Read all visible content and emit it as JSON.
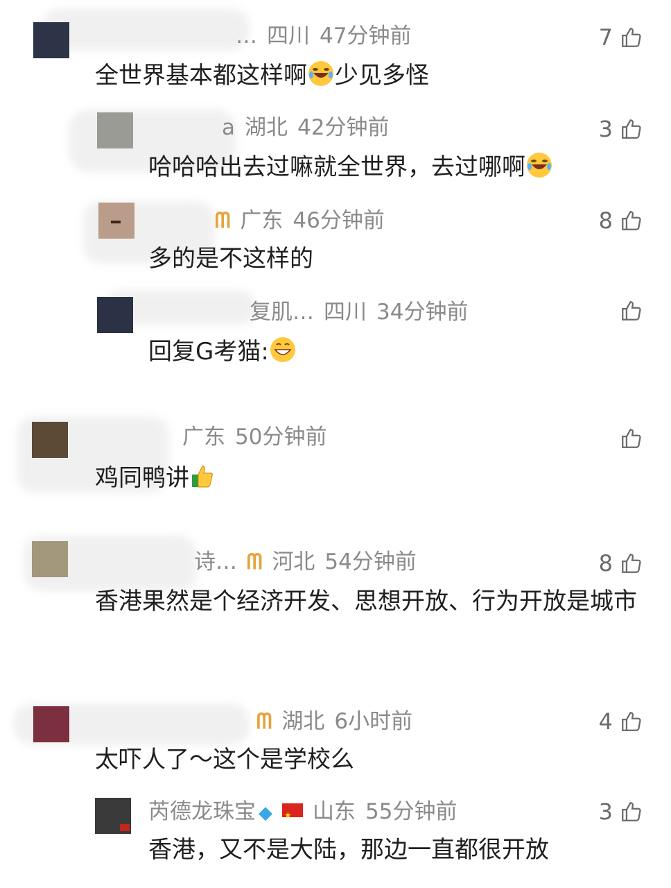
{
  "comments": [
    {
      "name_visible": "…",
      "location": "四川",
      "time": "47分钟前",
      "likes": "7",
      "text": "全世界基本都这样啊",
      "text_tail": "少见多怪",
      "emoji": "rofl"
    },
    {
      "name_visible": "a",
      "location": "湖北",
      "time": "42分钟前",
      "likes": "3",
      "text": "哈哈哈出去过嘛就全世界，去过哪啊",
      "emoji": "rofl"
    },
    {
      "name_visible": "",
      "location": "广东",
      "time": "46分钟前",
      "likes": "8",
      "text": "多的是不这样的",
      "badge": "ᗰ"
    },
    {
      "name_visible": "复肌…",
      "location": "四川",
      "time": "34分钟前",
      "likes": "",
      "text": "回复G考猫:",
      "emoji": "grin"
    },
    {
      "name_visible": "",
      "location": "广东",
      "time": "50分钟前",
      "likes": "",
      "text": "鸡同鸭讲",
      "emoji": "thumbs"
    },
    {
      "name_visible": "诗…",
      "location": "河北",
      "time": "54分钟前",
      "likes": "8",
      "text": "香港果然是个经济开发、思想开放、行为开放是城市",
      "badge": "ᗰ"
    },
    {
      "name_visible": "",
      "location": "湖北",
      "time": "6小时前",
      "likes": "4",
      "text": "太吓人了～这个是学校么",
      "badge": "ᗰ"
    },
    {
      "name_visible": "芮德龙珠宝",
      "location": "山东",
      "time": "55分钟前",
      "likes": "3",
      "text": "香港，又不是大陆，那边一直都很开放"
    }
  ],
  "colors": {
    "meta": "#8a8a8a",
    "text": "#1f1f1f",
    "badge": "#e6a23c"
  }
}
